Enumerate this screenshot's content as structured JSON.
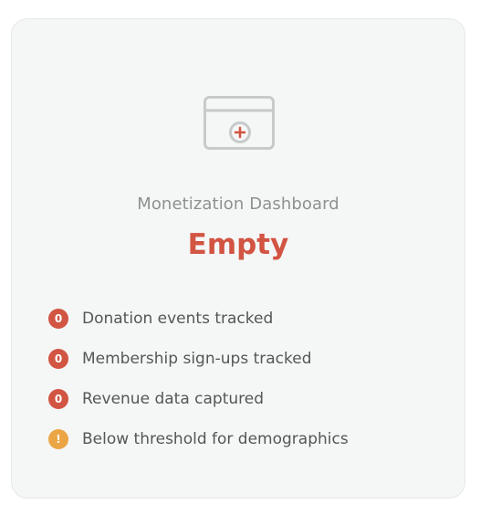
{
  "card": {
    "title": "Monetization Dashboard",
    "status": "Empty",
    "icon": "empty-dashboard-add-icon"
  },
  "metrics": [
    {
      "badge": "0",
      "label": "Donation events tracked",
      "type": "zero"
    },
    {
      "badge": "0",
      "label": "Membership sign-ups tracked",
      "type": "zero"
    },
    {
      "badge": "0",
      "label": "Revenue data captured",
      "type": "zero"
    },
    {
      "badge": "!",
      "label": "Below threshold for demographics",
      "type": "warning"
    }
  ],
  "colors": {
    "card_background": "#f5f6f6",
    "status": "#d25442",
    "zero_badge": "#d25442",
    "warning_badge": "#eba544",
    "icon_stroke": "#c8c9ca"
  }
}
